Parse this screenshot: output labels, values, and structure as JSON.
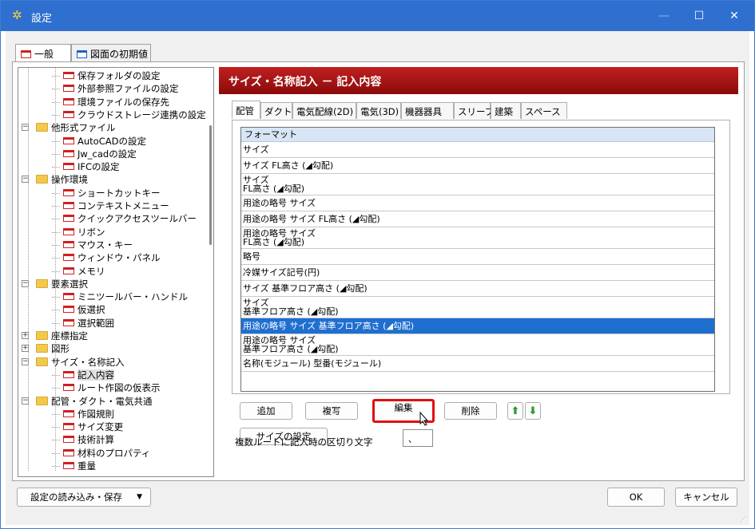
{
  "window": {
    "title": "設定",
    "settings_icon": "gear-icon",
    "minimize": "—",
    "maximize": "☐",
    "close": "✕"
  },
  "top_tabs": [
    {
      "label": "一般",
      "icon": "general-page-icon"
    },
    {
      "label": "図面の初期値",
      "icon": "drawing-page-icon"
    }
  ],
  "tree": {
    "items": [
      {
        "label": "保存フォルダの設定",
        "type": "page"
      },
      {
        "label": "外部参照ファイルの設定",
        "type": "page"
      },
      {
        "label": "環境ファイルの保存先",
        "type": "page"
      },
      {
        "label": "クラウドストレージ連携の設定",
        "type": "page"
      },
      {
        "label": "他形式ファイル",
        "type": "folder",
        "expander": "−"
      },
      {
        "label": "AutoCADの設定",
        "type": "page"
      },
      {
        "label": "Jw_cadの設定",
        "type": "page"
      },
      {
        "label": "IFCの設定",
        "type": "page"
      },
      {
        "label": "操作環境",
        "type": "folder",
        "expander": "−"
      },
      {
        "label": "ショートカットキー",
        "type": "page"
      },
      {
        "label": "コンテキストメニュー",
        "type": "page"
      },
      {
        "label": "クイックアクセスツールバー",
        "type": "page"
      },
      {
        "label": "リボン",
        "type": "page"
      },
      {
        "label": "マウス・キー",
        "type": "page"
      },
      {
        "label": "ウィンドウ・パネル",
        "type": "page"
      },
      {
        "label": "メモリ",
        "type": "page"
      },
      {
        "label": "要素選択",
        "type": "folder",
        "expander": "−"
      },
      {
        "label": "ミニツールバー・ハンドル",
        "type": "page"
      },
      {
        "label": "仮選択",
        "type": "page"
      },
      {
        "label": "選択範囲",
        "type": "page"
      },
      {
        "label": "座標指定",
        "type": "folder",
        "expander": "+"
      },
      {
        "label": "図形",
        "type": "folder",
        "expander": "+"
      },
      {
        "label": "サイズ・名称記入",
        "type": "folder",
        "expander": "−"
      },
      {
        "label": "記入内容",
        "type": "page",
        "selected": true
      },
      {
        "label": "ルート作図の仮表示",
        "type": "page"
      },
      {
        "label": "配管・ダクト・電気共通",
        "type": "folder",
        "expander": "−"
      },
      {
        "label": "作図規則",
        "type": "page"
      },
      {
        "label": "サイズ変更",
        "type": "page"
      },
      {
        "label": "技術計算",
        "type": "page"
      },
      {
        "label": "材料のプロパティ",
        "type": "page"
      },
      {
        "label": "重量",
        "type": "page"
      }
    ]
  },
  "content": {
    "header": "サイズ・名称記入 － 記入内容",
    "sub_tabs": [
      "配管",
      "ダクト",
      "電気配線(2D)",
      "電気(3D)",
      "機器器具",
      "スリーブ",
      "建築",
      "スペース"
    ],
    "list": {
      "header": "フォーマット",
      "rows": [
        {
          "lines": [
            "サイズ"
          ]
        },
        {
          "lines": [
            "サイズ FL高さ (◢勾配)"
          ]
        },
        {
          "lines": [
            "サイズ",
            "FL高さ (◢勾配)"
          ]
        },
        {
          "lines": [
            "用途の略号 サイズ"
          ]
        },
        {
          "lines": [
            "用途の略号 サイズ FL高さ (◢勾配)"
          ]
        },
        {
          "lines": [
            "用途の略号 サイズ",
            "FL高さ (◢勾配)"
          ]
        },
        {
          "lines": [
            "略号"
          ]
        },
        {
          "lines": [
            "冷媒サイズ記号(円)"
          ]
        },
        {
          "lines": [
            "サイズ 基準フロア高さ (◢勾配)"
          ]
        },
        {
          "lines": [
            "サイズ",
            "基準フロア高さ (◢勾配)"
          ]
        },
        {
          "lines": [
            "用途の略号 サイズ 基準フロア高さ (◢勾配)"
          ],
          "selected": true
        },
        {
          "lines": [
            "用途の略号 サイズ",
            "基準フロア高さ (◢勾配)"
          ]
        },
        {
          "lines": [
            "名称(モジュール) 型番(モジュール)"
          ]
        }
      ]
    },
    "buttons": {
      "add": "追加",
      "copy": "複写",
      "edit": "編集",
      "delete": "削除",
      "up": "⬆",
      "down": "⬇",
      "size_settings": "サイズの設定"
    },
    "separator_label": "複数ルートに記入時の区切り文字",
    "separator_value": "、"
  },
  "bottom": {
    "load_save": "設定の読み込み・保存",
    "load_save_arrow": "▼",
    "ok": "OK",
    "cancel": "キャンセル"
  },
  "colors": {
    "titlebar": "#2f6fcf",
    "header": "#b01818",
    "selected_row": "#1f6fd0",
    "highlight": "#e01010"
  }
}
